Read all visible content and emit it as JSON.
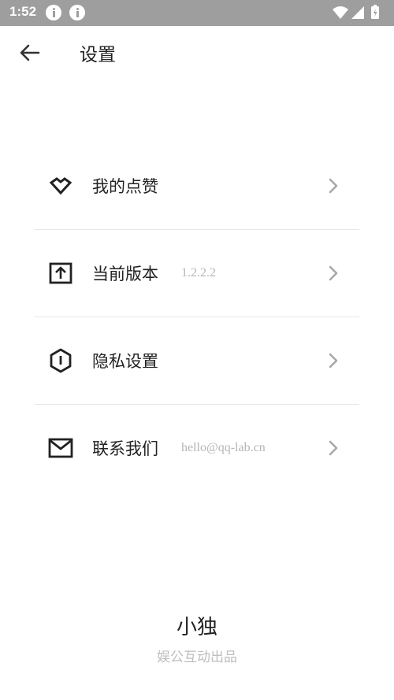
{
  "status_bar": {
    "time": "1:52",
    "icons": [
      "info-icon",
      "info-icon",
      "wifi-icon",
      "signal-icon",
      "battery-charging-icon"
    ]
  },
  "header": {
    "title": "设置",
    "back_icon": "arrow-left-icon"
  },
  "settings": {
    "items": [
      {
        "label": "我的点赞",
        "value": "",
        "icon": "heart-outline-icon"
      },
      {
        "label": "当前版本",
        "value": "1.2.2.2",
        "icon": "upload-box-icon"
      },
      {
        "label": "隐私设置",
        "value": "",
        "icon": "shield-hexagon-icon"
      },
      {
        "label": "联系我们",
        "value": "hello@qq-lab.cn",
        "icon": "mail-icon"
      }
    ]
  },
  "footer": {
    "app_name": "小独",
    "company": "娱公互动出品"
  },
  "colors": {
    "status_bar": "#9e9e9e",
    "divider": "#e7e7e7",
    "secondary_text": "#b5b5b5",
    "chevron": "#a8a8a8"
  }
}
